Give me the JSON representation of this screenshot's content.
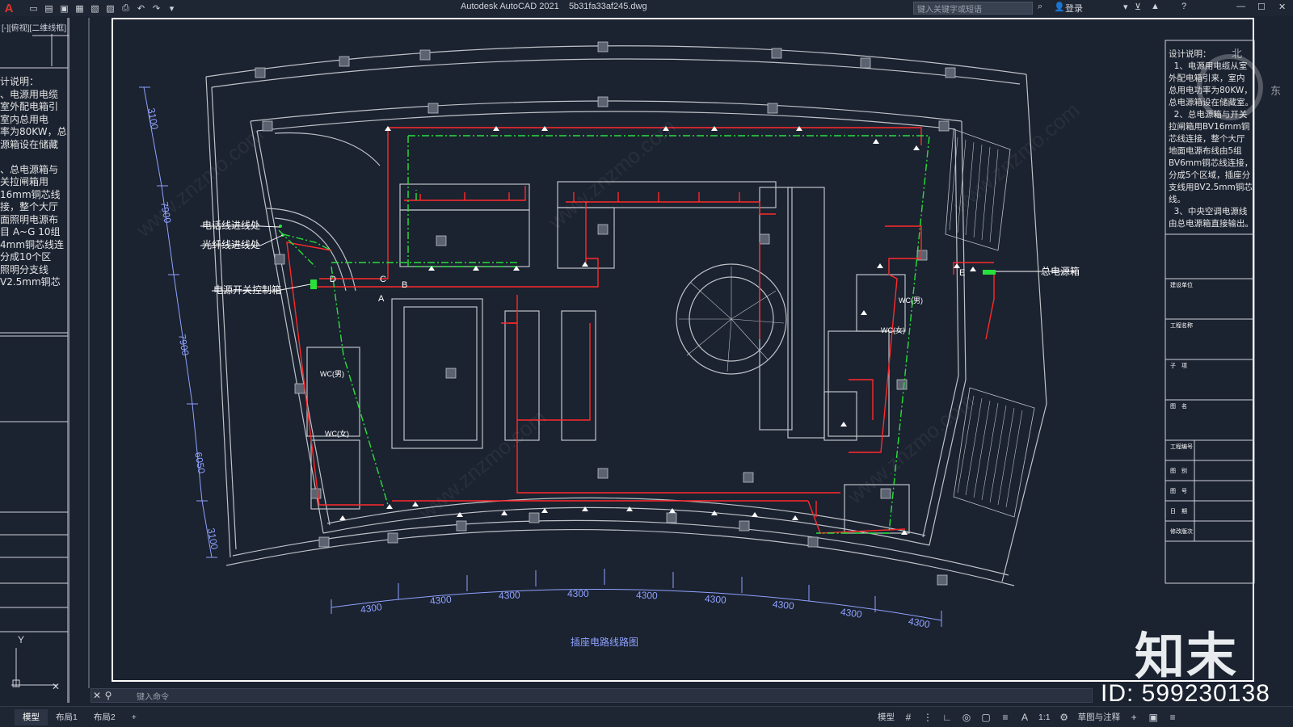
{
  "app": {
    "logo": "A",
    "title": "Autodesk AutoCAD 2021",
    "file": "5b31fa33af245.dwg",
    "search_placeholder": "键入关键字或短语",
    "login": "登录"
  },
  "viewport": {
    "label": "[-][俯视][二维线框]"
  },
  "left_notes": "计说明：\n、电源用电缆\n室外配电箱引\n室内总用电\n率为80KW，总\n源箱设在储藏\n\n、总电源箱与\n关拉闸箱用\n16mm铜芯线\n接，整个大厅\n面照明电源布\n目 A~G 10组\n4mm铜芯线连\n分成10个区\n照明分支线\nV2.5mm铜芯",
  "design_notes": "设计说明：\n  1、电源用电缆从室\n外配电箱引来，室内\n总用电功率为80KW，\n总电源箱设在储藏室。\n  2、总电源箱与开关\n拉闸箱用BV16mm铜\n芯线连接，整个大厅\n地面电源布线由5组\nBV6mm铜芯线连接，\n分成5个区域，插座分\n支线用BV2.5mm铜芯\n线。\n  3、中央空调电源线\n由总电源箱直接输出。",
  "compass": {
    "north": "北",
    "east": "东"
  },
  "labels": {
    "phone_line": "电话线进线处",
    "fiber_line": "光纤线进线处",
    "switch_box": "电源开关控制箱",
    "main_box": "总电源箱",
    "A": "A",
    "B": "B",
    "C": "C",
    "D": "D",
    "E": "E",
    "wc1": "WC(男)",
    "wc2": "WC(女)",
    "wc3": "WC(男)",
    "wc4": "WC(女)"
  },
  "dims_bottom": [
    "4300",
    "4300",
    "4300",
    "4300",
    "4300",
    "4300",
    "4300",
    "4300",
    "4300"
  ],
  "dims_left": [
    "3100",
    "7900",
    "7900",
    "6050",
    "3100"
  ],
  "drawing_title": "插座电路线路图",
  "titleblock_rows": [
    "建设单位",
    "工程名称",
    "子　项",
    "图　名",
    "工程编号",
    "图　别",
    "图　号",
    "日　期",
    "修改版次"
  ],
  "watermark_text": "www.znzmo.com",
  "brand": "知末",
  "id_tag": "ID: 599230138",
  "command": {
    "placeholder": "键入命令"
  },
  "tabs": [
    "模型",
    "布局1",
    "布局2",
    "+"
  ],
  "status": {
    "model": "模型",
    "scale": "1:1",
    "workspace": "草图与注释"
  },
  "colors": {
    "bg": "#1b2230",
    "red_circuit": "#ff2a2a",
    "green_circuit": "#28e03a",
    "wall": "#bfc3c8",
    "dim": "#8fa3ff"
  }
}
